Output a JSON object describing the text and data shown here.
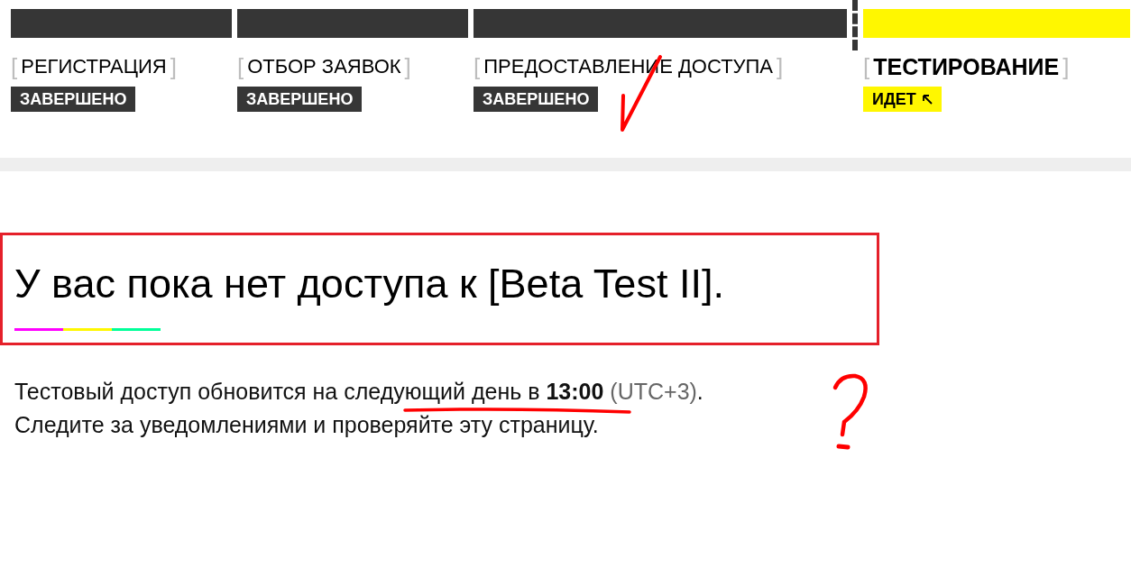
{
  "stages": [
    {
      "label": "РЕГИСТРАЦИЯ",
      "status": "ЗАВЕРШЕНО",
      "current": false
    },
    {
      "label": "ОТБОР ЗАЯВОК",
      "status": "ЗАВЕРШЕНО",
      "current": false
    },
    {
      "label": "ПРЕДОСТАВЛЕНИЕ ДОСТУПА",
      "status": "ЗАВЕРШЕНО",
      "current": false
    },
    {
      "label": "ТЕСТИРОВАНИЕ",
      "status": "ИДЕТ",
      "current": true
    }
  ],
  "brackets": {
    "open": "[",
    "close": "]"
  },
  "heading": "У вас пока нет доступа к [Beta Test II].",
  "notice": [
    {
      "text": "Тестовый доступ обновится на следующий день в **13:00**",
      "note": "(UTC+3)",
      "end": "."
    },
    {
      "text": "Следите за уведомлениями и проверяйте эту страницу."
    }
  ]
}
